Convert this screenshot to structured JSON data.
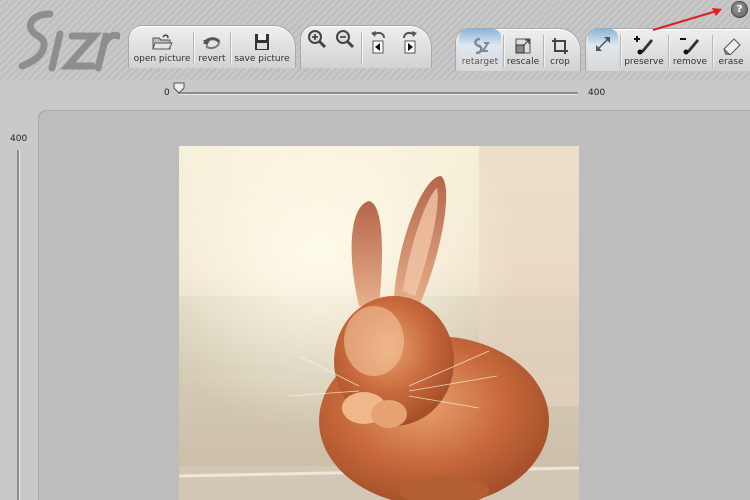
{
  "toolbar": {
    "file": {
      "open_label": "open picture",
      "revert_label": "revert",
      "save_label": "save picture"
    },
    "mode": {
      "retarget_label": "retarget",
      "rescale_label": "rescale",
      "crop_label": "crop"
    },
    "brush": {
      "preserve_label": "preserve",
      "remove_label": "remove",
      "erase_label": "erase"
    },
    "help_label": "?"
  },
  "width_slider": {
    "min_label": "0",
    "max_label": "400",
    "value": 0
  },
  "height_slider": {
    "max_label": "400"
  },
  "colors": {
    "active_tab": "#8bb6d9",
    "annotation_arrow": "#e02020"
  }
}
